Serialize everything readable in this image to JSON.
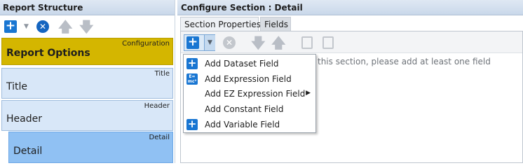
{
  "left_pane": {
    "title": "Report Structure",
    "toolbar": {
      "add_icon": "plus-square-icon",
      "dropdown_icon": "chevron-down-icon",
      "delete_icon": "circle-x-icon",
      "move_up_icon": "arrow-up-icon",
      "move_down_icon": "arrow-down-icon"
    },
    "sections": [
      {
        "name": "Report Options",
        "tag": "Configuration",
        "color": "#d4b600"
      },
      {
        "name": "Title",
        "tag": "Title",
        "color": "#d8e7f8"
      },
      {
        "name": "Header",
        "tag": "Header",
        "color": "#d8e7f8"
      },
      {
        "name": "Detail",
        "tag": "Detail",
        "color": "#90c1f3"
      }
    ]
  },
  "right_pane": {
    "title": "Configure Section : Detail",
    "tabs": [
      {
        "label": "Section Properties",
        "active": false
      },
      {
        "label": "Fields",
        "active": true
      }
    ],
    "toolbar": {
      "add_icon": "plus-square-icon",
      "dropdown_icon": "chevron-down-icon",
      "delete_icon": "circle-x-icon",
      "move_down_icon": "arrow-down-icon",
      "move_up_icon": "arrow-up-icon",
      "copy_icon": "copy-icon",
      "paste_icon": "paste-icon"
    },
    "hint": "this section, please add at least one field"
  },
  "add_menu": {
    "items": [
      {
        "label": "Add Dataset Field",
        "icon": "plus-square-icon",
        "submenu": false
      },
      {
        "label": "Add Expression Field",
        "icon": "emc-formula-icon",
        "submenu": false
      },
      {
        "label": "Add EZ Expression Field",
        "icon": "",
        "submenu": true
      },
      {
        "label": "Add Constant Field",
        "icon": "",
        "submenu": false
      },
      {
        "label": "Add Variable Field",
        "icon": "plus-square-icon",
        "submenu": false
      }
    ]
  },
  "colors": {
    "accent_blue": "#1976d2",
    "config_section": "#d4b600",
    "selected_section": "#90c1f3"
  }
}
